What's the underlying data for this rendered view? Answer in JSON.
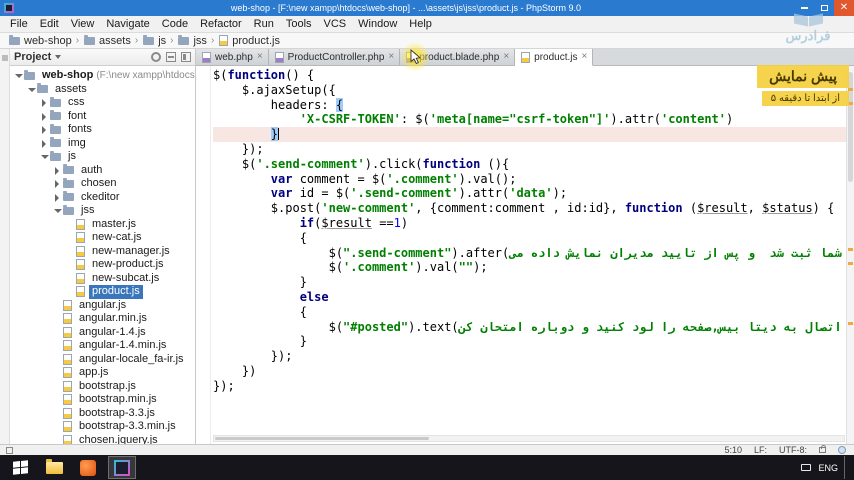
{
  "window": {
    "title": "web-shop - [F:\\new xampp\\htdocs\\web-shop] - ...\\assets\\js\\jss\\product.js - PhpStorm 9.0"
  },
  "menu_bar": {
    "items": [
      "File",
      "Edit",
      "View",
      "Navigate",
      "Code",
      "Refactor",
      "Run",
      "Tools",
      "VCS",
      "Window",
      "Help"
    ]
  },
  "breadcrumb": {
    "separator": "›",
    "items": [
      {
        "label": "web-shop",
        "icon": "folder"
      },
      {
        "label": "assets",
        "icon": "folder"
      },
      {
        "label": "js",
        "icon": "folder"
      },
      {
        "label": "jss",
        "icon": "folder"
      },
      {
        "label": "product.js",
        "icon": "js-file"
      }
    ]
  },
  "project_panel": {
    "title": "Project"
  },
  "editor_tabs": [
    {
      "label": "web.php",
      "icon": "php-file",
      "active": false
    },
    {
      "label": "ProductController.php",
      "icon": "php-file",
      "active": false
    },
    {
      "label": "product.blade.php",
      "icon": "php-file",
      "active": false
    },
    {
      "label": "product.js",
      "icon": "js-file",
      "active": true
    }
  ],
  "project_tree": [
    {
      "label": "web-shop",
      "suffix": "(F:\\new xampp\\htdocs\\web-shop)",
      "level": 0,
      "kind": "folder",
      "state": "expanded",
      "root": true
    },
    {
      "label": "assets",
      "level": 1,
      "kind": "folder",
      "state": "expanded"
    },
    {
      "label": "css",
      "level": 2,
      "kind": "folder",
      "state": "collapsed"
    },
    {
      "label": "font",
      "level": 2,
      "kind": "folder",
      "state": "collapsed"
    },
    {
      "label": "fonts",
      "level": 2,
      "kind": "folder",
      "state": "collapsed"
    },
    {
      "label": "img",
      "level": 2,
      "kind": "folder",
      "state": "collapsed"
    },
    {
      "label": "js",
      "level": 2,
      "kind": "folder",
      "state": "expanded"
    },
    {
      "label": "auth",
      "level": 3,
      "kind": "folder",
      "state": "collapsed"
    },
    {
      "label": "chosen",
      "level": 3,
      "kind": "folder",
      "state": "collapsed"
    },
    {
      "label": "ckeditor",
      "level": 3,
      "kind": "folder",
      "state": "collapsed"
    },
    {
      "label": "jss",
      "level": 3,
      "kind": "folder",
      "state": "expanded"
    },
    {
      "label": "master.js",
      "level": 4,
      "kind": "js-file"
    },
    {
      "label": "new-cat.js",
      "level": 4,
      "kind": "js-file"
    },
    {
      "label": "new-manager.js",
      "level": 4,
      "kind": "js-file"
    },
    {
      "label": "new-product.js",
      "level": 4,
      "kind": "js-file"
    },
    {
      "label": "new-subcat.js",
      "level": 4,
      "kind": "js-file"
    },
    {
      "label": "product.js",
      "level": 4,
      "kind": "js-file",
      "selected": true
    },
    {
      "label": "angular.js",
      "level": 3,
      "kind": "js-file"
    },
    {
      "label": "angular.min.js",
      "level": 3,
      "kind": "js-file"
    },
    {
      "label": "angular-1.4.js",
      "level": 3,
      "kind": "js-file"
    },
    {
      "label": "angular-1.4.min.js",
      "level": 3,
      "kind": "js-file"
    },
    {
      "label": "angular-locale_fa-ir.js",
      "level": 3,
      "kind": "js-file"
    },
    {
      "label": "app.js",
      "level": 3,
      "kind": "js-file"
    },
    {
      "label": "bootstrap.js",
      "level": 3,
      "kind": "js-file"
    },
    {
      "label": "bootstrap.min.js",
      "level": 3,
      "kind": "js-file"
    },
    {
      "label": "bootstrap-3.3.js",
      "level": 3,
      "kind": "js-file"
    },
    {
      "label": "bootstrap-3.3.min.js",
      "level": 3,
      "kind": "js-file"
    },
    {
      "label": "chosen.jquery.js",
      "level": 3,
      "kind": "js-file"
    }
  ],
  "code": {
    "lines": [
      {
        "segments": [
          [
            "p",
            "$("
          ],
          [
            "k",
            "function"
          ],
          [
            "p",
            "() {"
          ]
        ]
      },
      {
        "segments": [
          [
            "p",
            "    $.ajaxSetup({"
          ]
        ]
      },
      {
        "segments": [
          [
            "p",
            "        headers: "
          ],
          [
            "bm",
            "{"
          ]
        ]
      },
      {
        "segments": [
          [
            "p",
            "            "
          ],
          [
            "s",
            "'X-CSRF-TOKEN'"
          ],
          [
            "p",
            ": $("
          ],
          [
            "s",
            "'meta[name=\"csrf-token\"]'"
          ],
          [
            "p",
            ").attr("
          ],
          [
            "s",
            "'content'"
          ],
          [
            "p",
            ")"
          ]
        ]
      },
      {
        "caret": true,
        "segments": [
          [
            "p",
            "        "
          ],
          [
            "bm",
            "}"
          ]
        ]
      },
      {
        "segments": [
          [
            "p",
            "    });"
          ]
        ]
      },
      {
        "segments": [
          [
            "p",
            "    $("
          ],
          [
            "s",
            "'.send-comment'"
          ],
          [
            "p",
            ").click("
          ],
          [
            "k",
            "function"
          ],
          [
            "p",
            " (){"
          ]
        ]
      },
      {
        "segments": [
          [
            "p",
            "        "
          ],
          [
            "k",
            "var"
          ],
          [
            "p",
            " comment = $("
          ],
          [
            "s",
            "'.comment'"
          ],
          [
            "p",
            ").val();"
          ]
        ]
      },
      {
        "segments": [
          [
            "p",
            "        "
          ],
          [
            "k",
            "var"
          ],
          [
            "p",
            " id = $("
          ],
          [
            "s",
            "'.send-comment'"
          ],
          [
            "p",
            ").attr("
          ],
          [
            "s",
            "'data'"
          ],
          [
            "p",
            ");"
          ]
        ]
      },
      {
        "segments": [
          [
            "p",
            "        $.post("
          ],
          [
            "s",
            "'new-comment'"
          ],
          [
            "p",
            ", {comment:comment , id:id}, "
          ],
          [
            "k",
            "function"
          ],
          [
            "p",
            " ("
          ],
          [
            "u",
            "$result"
          ],
          [
            "p",
            ", "
          ],
          [
            "u",
            "$status"
          ],
          [
            "p",
            ") {"
          ]
        ]
      },
      {
        "segments": [
          [
            "p",
            "            "
          ],
          [
            "k",
            "if"
          ],
          [
            "p",
            "("
          ],
          [
            "u",
            "$result"
          ],
          [
            "p",
            " =="
          ],
          [
            "n",
            "1"
          ],
          [
            "p",
            ")"
          ]
        ]
      },
      {
        "segments": [
          [
            "p",
            "            {"
          ]
        ]
      },
      {
        "segments": [
          [
            "p",
            "                $("
          ],
          [
            "s",
            "\".send-comment\""
          ],
          [
            "p",
            ").after("
          ],
          [
            "fa",
            "دیدگاه شما ثبت شد  و پس از تایید مدیران نمایش داده می"
          ]
        ]
      },
      {
        "segments": [
          [
            "p",
            "                $("
          ],
          [
            "s",
            "'.comment'"
          ],
          [
            "p",
            ").val("
          ],
          [
            "s",
            "\"\""
          ],
          [
            "p",
            ");"
          ]
        ]
      },
      {
        "segments": [
          [
            "p",
            "            }"
          ]
        ]
      },
      {
        "segments": [
          [
            "p",
            "            "
          ],
          [
            "k",
            "else"
          ]
        ]
      },
      {
        "segments": [
          [
            "p",
            "            {"
          ]
        ]
      },
      {
        "segments": [
          [
            "p",
            "                $("
          ],
          [
            "s",
            "\"#posted\""
          ],
          [
            "p",
            ").text("
          ],
          [
            "fa",
            "خطا در اتصال به دیتا بیس,صفحه را لود کنید و دوباره امتحان کن"
          ]
        ]
      },
      {
        "segments": [
          [
            "p",
            "            }"
          ]
        ]
      },
      {
        "segments": [
          [
            "p",
            "        });"
          ]
        ]
      },
      {
        "segments": [
          [
            "p",
            "    })"
          ]
        ]
      },
      {
        "segments": [
          [
            "p",
            "});"
          ]
        ]
      }
    ]
  },
  "overlay_badge": {
    "title": "پیش نمایش",
    "subtitle": "از ابتدا تا دقیقه ۵"
  },
  "watermark": {
    "text": "فرادرس"
  },
  "status_bar": {
    "caret_position": "5:10",
    "line_separator": "LF:",
    "encoding": "UTF-8:"
  },
  "taskbar": {
    "language": "ENG"
  }
}
